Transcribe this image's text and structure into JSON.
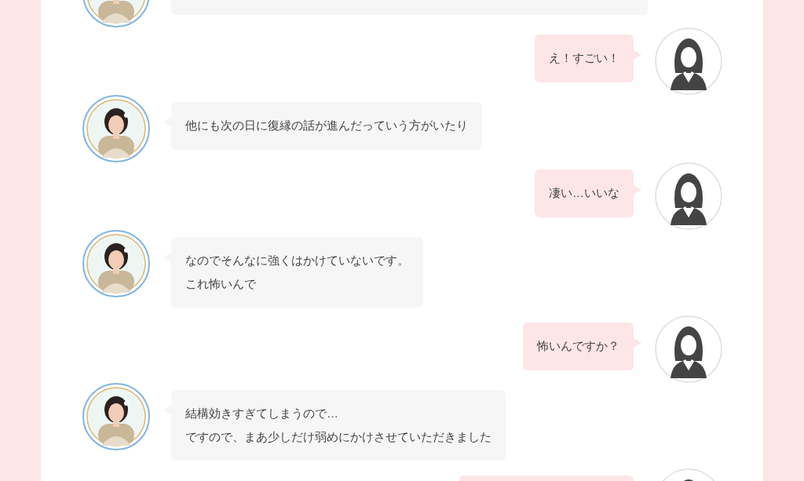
{
  "messages": [
    {
      "kind": "received"
    },
    {
      "kind": "sent",
      "lines": [
        "え！すごい！"
      ]
    },
    {
      "kind": "received",
      "lines": [
        "他にも次の日に復縁の話が進んだっていう方がいたり"
      ]
    },
    {
      "kind": "sent",
      "lines": [
        "凄い…いいな"
      ]
    },
    {
      "kind": "received",
      "lines": [
        "なのでそんなに強くはかけていないです。",
        "これ怖いんで"
      ]
    },
    {
      "kind": "sent",
      "lines": [
        "怖いんですか？"
      ]
    },
    {
      "kind": "received",
      "lines": [
        "結構効きすぎてしまうので…",
        "ですので、まあ少しだけ弱めにかけさせていただきました"
      ]
    },
    {
      "kind": "sent"
    }
  ]
}
